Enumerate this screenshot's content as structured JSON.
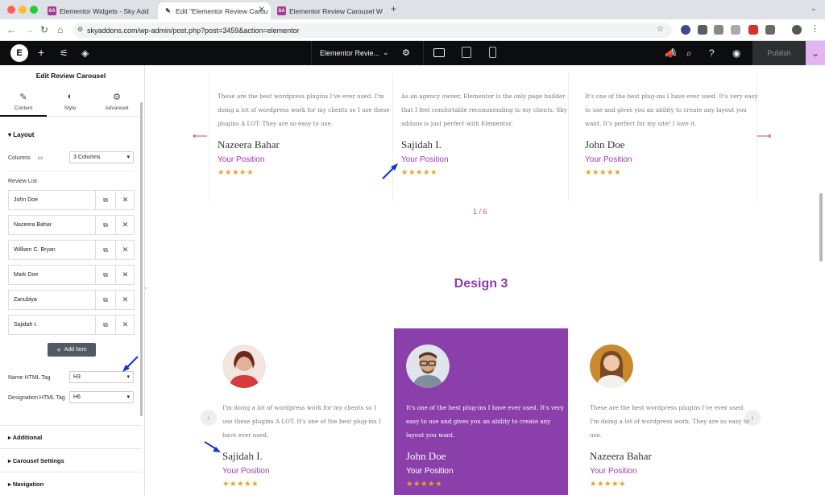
{
  "browser": {
    "tabs": [
      {
        "icon": "SA",
        "label": "Elementor Widgets - Sky Add"
      },
      {
        "icon": "✎",
        "label": "Edit \"Elementor Review Carou"
      },
      {
        "icon": "SA",
        "label": "Elementor Review Carousel W"
      }
    ],
    "url": "skyaddons.com/wp-admin/post.php?post=3459&action=elementor"
  },
  "editor_bar": {
    "logo": "E",
    "doc_title": "Elementor Revie...",
    "publish": "Publish"
  },
  "panel": {
    "title": "Edit Review Carousel",
    "tabs": [
      {
        "icon": "✎",
        "label": "Content"
      },
      {
        "icon": "◐",
        "label": "Style"
      },
      {
        "icon": "⚙",
        "label": "Advanced"
      }
    ],
    "layout_section": "Layout",
    "columns_label": "Columns",
    "columns_value": "3 Columns",
    "review_list_label": "Review List",
    "reviews": [
      "John Doe",
      "Nazeera Bahar",
      "William C. Bryan",
      "Mark Doe",
      "Zanubiya",
      "Sajidah I."
    ],
    "add_item": "Add Item",
    "name_tag_label": "Name HTML Tag",
    "name_tag_value": "H3",
    "designation_tag_label": "Designation HTML Tag",
    "designation_tag_value": "H6",
    "sections": [
      "Additional",
      "Carousel Settings",
      "Navigation"
    ]
  },
  "design2": {
    "cards": [
      {
        "quote": "These are the best wordpress plugins I've ever used. I'm doing a lot of wordpress work for my clients so I use these plugins A LOT. They are so easy to use.",
        "name": "Nazeera Bahar",
        "position": "Your Position",
        "stars": "★★★★★"
      },
      {
        "quote": "As an agency owner, Elementor is the only page builder that I feel comfortable recommending to my clients. Sky addons is just perfect with Elementor.",
        "name": "Sajidah I.",
        "position": "Your Position",
        "stars": "★★★★★"
      },
      {
        "quote": "It's one of the best plug-ins I have ever used. It's very easy to use and gives you an ability to create any layout you want. It's perfect for my site! I love it.",
        "name": "John Doe",
        "position": "Your Position",
        "stars": "★★★★★"
      }
    ],
    "pager": "1 / 6"
  },
  "design3": {
    "title": "Design 3",
    "cards": [
      {
        "quote": "I'm doing a lot of wordpress work for my clients so I use these plugins A LOT. It's one of the best plug-ins I have ever used.",
        "name": "Sajidah I.",
        "position": "Your Position",
        "stars": "★★★★★",
        "avatar_bg": "#c73b3b"
      },
      {
        "quote": "It's one of the best plug-ins I have ever used. It's very easy to use and gives you an ability to create any layout you want.",
        "name": "John Doe",
        "position": "Your Position",
        "stars": "★★★★★",
        "avatar_bg": "#8c9aa8"
      },
      {
        "quote": "These are the best wordpress plugins I've ever used. I'm doing a lot of wordpress work. They are so easy to use.",
        "name": "Nazeera Bahar",
        "position": "Your Position",
        "stars": "★★★★★",
        "avatar_bg": "#c98a2e"
      }
    ]
  },
  "colors": {
    "accent": "#8a3fab",
    "star": "#e6a428",
    "arrow": "#c2487e"
  }
}
